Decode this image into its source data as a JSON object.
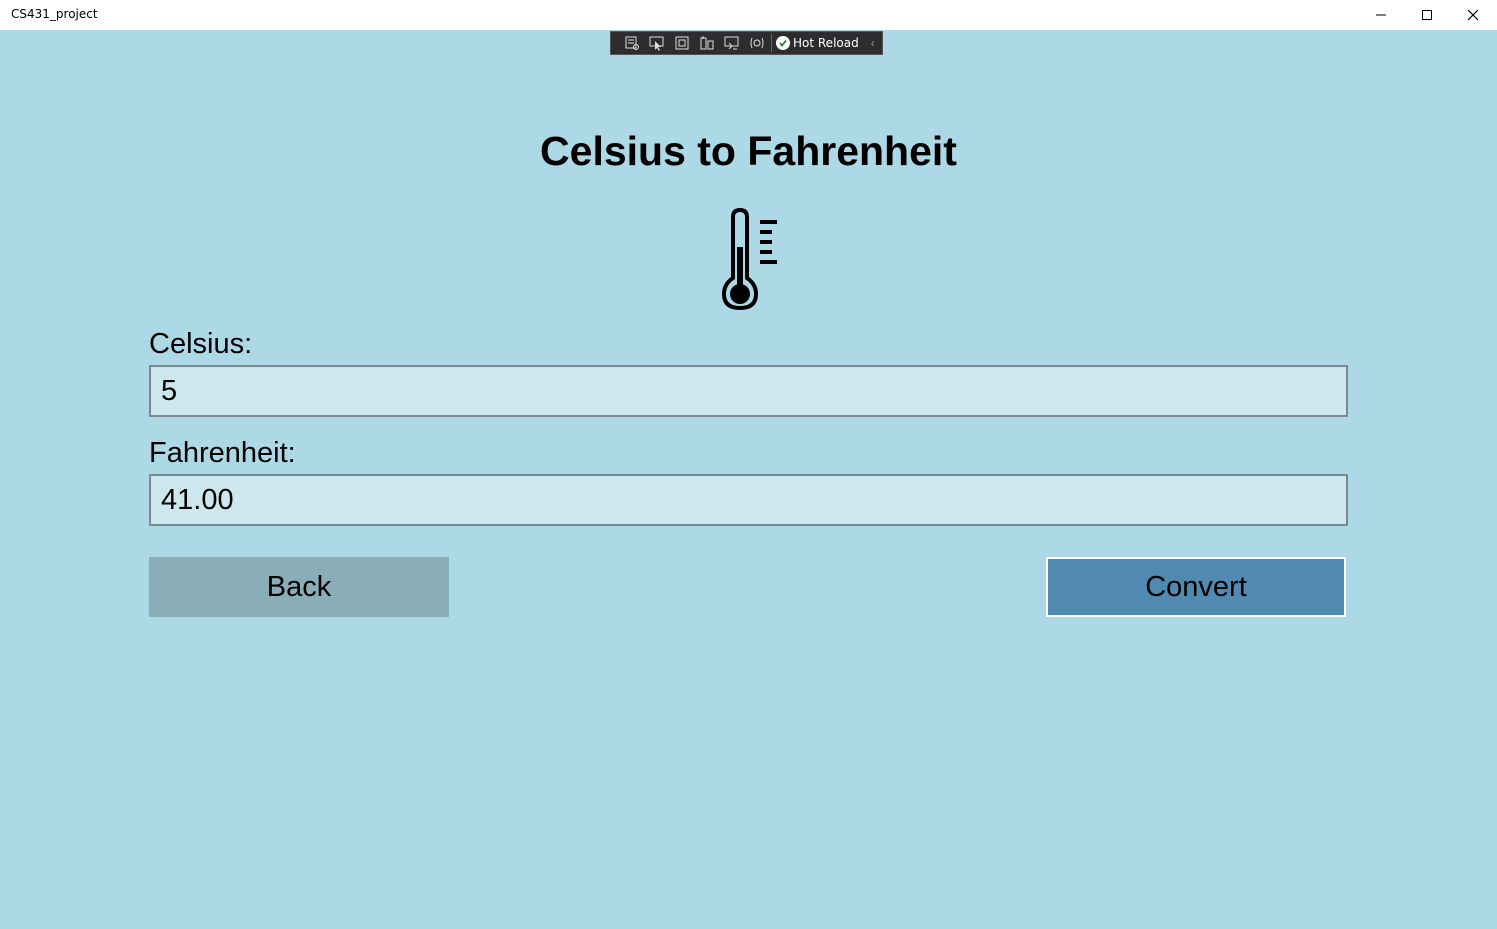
{
  "window": {
    "title": "CS431_project"
  },
  "debug_toolbar": {
    "hot_reload_label": "Hot Reload",
    "icons": [
      "live-visual-tree-icon",
      "select-element-icon",
      "display-layout-adorners-icon",
      "track-focus-icon",
      "binding-failures-icon",
      "accessibility-icon"
    ]
  },
  "page": {
    "title": "Celsius to Fahrenheit",
    "celsius_label": "Celsius:",
    "celsius_value": "5",
    "fahrenheit_label": "Fahrenheit:",
    "fahrenheit_value": "41.00",
    "back_label": "Back",
    "convert_label": "Convert"
  },
  "colors": {
    "background": "#ADD8E6",
    "field_background": "#CDE7EE",
    "back_button": "#8AAEB8",
    "convert_button": "#508AB0"
  }
}
